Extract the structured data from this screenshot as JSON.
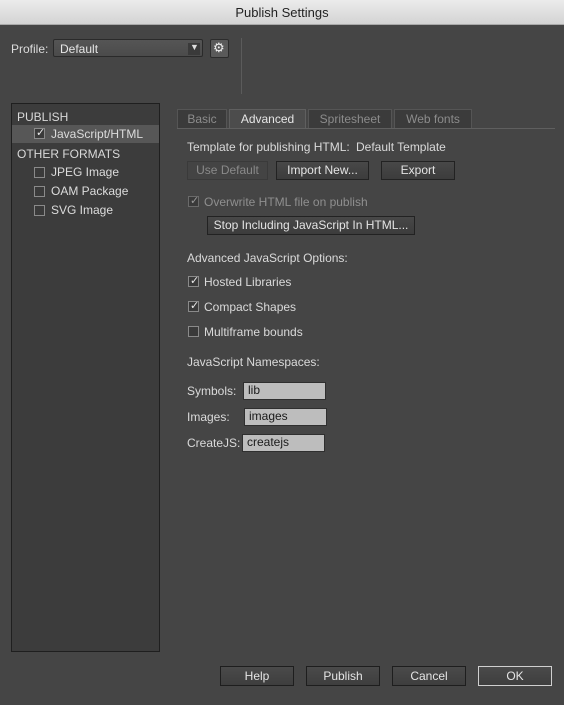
{
  "window": {
    "title": "Publish Settings"
  },
  "profile": {
    "label": "Profile:",
    "value": "Default",
    "arrow_icon": "chevron-down-icon",
    "gear_icon": "gear-icon"
  },
  "sidebar": {
    "publish_header": "PUBLISH",
    "publish_items": [
      {
        "label": "JavaScript/HTML",
        "checked": true,
        "selected": true
      }
    ],
    "other_header": "OTHER FORMATS",
    "other_items": [
      {
        "label": "JPEG Image",
        "checked": false
      },
      {
        "label": "OAM Package",
        "checked": false
      },
      {
        "label": "SVG Image",
        "checked": false
      }
    ]
  },
  "tabs": [
    {
      "label": "Basic",
      "active": false
    },
    {
      "label": "Advanced",
      "active": true
    },
    {
      "label": "Spritesheet",
      "active": false
    },
    {
      "label": "Web fonts",
      "active": false
    }
  ],
  "advanced": {
    "template_label": "Template for publishing HTML:",
    "template_value": "Default Template",
    "use_default": "Use Default",
    "import_new": "Import New...",
    "export": "Export",
    "overwrite_label": "Overwrite HTML file on publish",
    "overwrite_checked": true,
    "stop_including": "Stop Including JavaScript In HTML...",
    "js_options_header": "Advanced JavaScript Options:",
    "options": [
      {
        "label": "Hosted Libraries",
        "checked": true
      },
      {
        "label": "Compact Shapes",
        "checked": true
      },
      {
        "label": "Multiframe bounds",
        "checked": false
      }
    ],
    "namespaces_header": "JavaScript Namespaces:",
    "symbols_label": "Symbols:",
    "symbols_value": "lib",
    "images_label": "Images:",
    "images_value": "images",
    "createjs_label": "CreateJS:",
    "createjs_value": "createjs"
  },
  "footer": {
    "help": "Help",
    "publish": "Publish",
    "cancel": "Cancel",
    "ok": "OK"
  },
  "check_glyph": "✓"
}
